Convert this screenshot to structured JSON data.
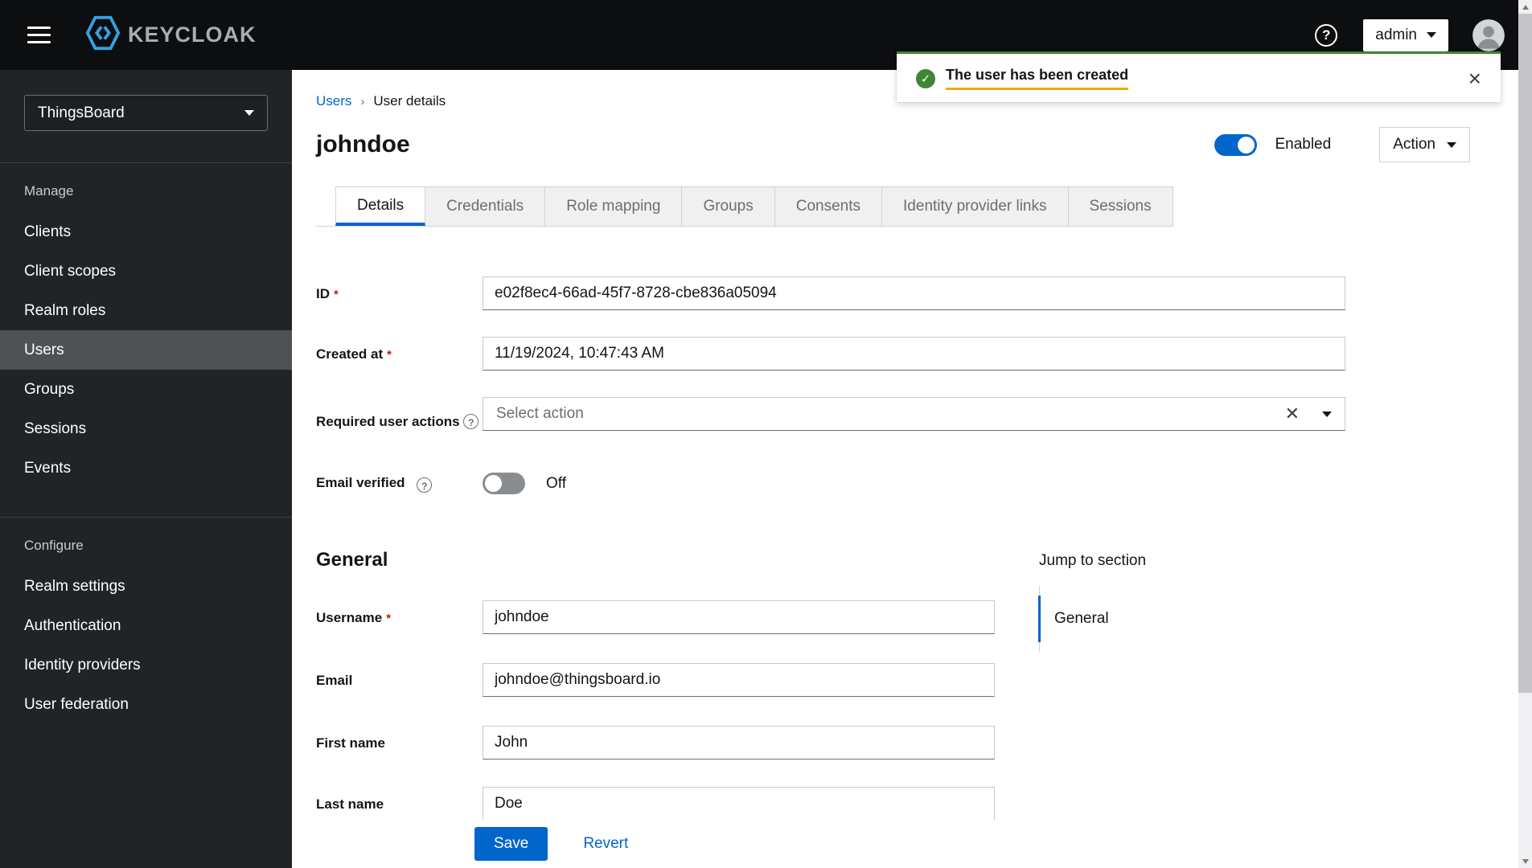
{
  "colors": {
    "accent": "#0066cc",
    "success": "#3e8635",
    "gold_underline": "#f0ab00"
  },
  "header": {
    "brand": "KEYCLOAK",
    "help_icon": "question-circle-icon",
    "user_menu": {
      "label": "admin"
    }
  },
  "sidebar": {
    "realm": {
      "selected": "ThingsBoard"
    },
    "sections": [
      {
        "heading": "Manage",
        "items": [
          {
            "label": "Clients",
            "active": false
          },
          {
            "label": "Client scopes",
            "active": false
          },
          {
            "label": "Realm roles",
            "active": false
          },
          {
            "label": "Users",
            "active": true
          },
          {
            "label": "Groups",
            "active": false
          },
          {
            "label": "Sessions",
            "active": false
          },
          {
            "label": "Events",
            "active": false
          }
        ]
      },
      {
        "heading": "Configure",
        "items": [
          {
            "label": "Realm settings",
            "active": false
          },
          {
            "label": "Authentication",
            "active": false
          },
          {
            "label": "Identity providers",
            "active": false
          },
          {
            "label": "User federation",
            "active": false
          }
        ]
      }
    ]
  },
  "toast": {
    "message": "The user has been created"
  },
  "breadcrumb": {
    "link": "Users",
    "separator": "›",
    "current": "User details"
  },
  "page_header": {
    "title": "johndoe",
    "enabled_toggle": {
      "label": "Enabled",
      "state": "on"
    },
    "action_button": {
      "label": "Action"
    }
  },
  "tabs": [
    {
      "label": "Details",
      "active": true
    },
    {
      "label": "Credentials",
      "active": false
    },
    {
      "label": "Role mapping",
      "active": false
    },
    {
      "label": "Groups",
      "active": false
    },
    {
      "label": "Consents",
      "active": false
    },
    {
      "label": "Identity provider links",
      "active": false
    },
    {
      "label": "Sessions",
      "active": false
    }
  ],
  "form": {
    "fields": {
      "id": {
        "label": "ID",
        "required": "*",
        "value": "e02f8ec4-66ad-45f7-8728-cbe836a05094"
      },
      "created_at": {
        "label": "Created at",
        "required": "*",
        "value": "11/19/2024, 10:47:43 AM"
      },
      "required_user_actions": {
        "label": "Required user actions",
        "placeholder": "Select action"
      },
      "email_verified": {
        "label": "Email verified",
        "state_label": "Off",
        "state": "off"
      }
    },
    "general": {
      "heading": "General",
      "username": {
        "label": "Username",
        "required": "*",
        "value": "johndoe"
      },
      "email": {
        "label": "Email",
        "value": "johndoe@thingsboard.io"
      },
      "first_name": {
        "label": "First name",
        "value": "John"
      },
      "last_name": {
        "label": "Last name",
        "value": "Doe"
      }
    }
  },
  "jump_to_section": {
    "heading": "Jump to section",
    "items": [
      {
        "label": "General",
        "active": true
      }
    ]
  },
  "footer": {
    "save": "Save",
    "revert": "Revert"
  }
}
